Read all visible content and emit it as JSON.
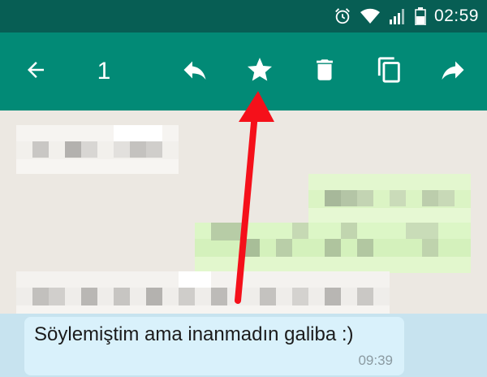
{
  "status_bar": {
    "time": "02:59",
    "icons": [
      "alarm-icon",
      "wifi-icon",
      "signal-icon",
      "battery-icon"
    ]
  },
  "action_bar": {
    "selected_count": "1",
    "actions": [
      "back-arrow-icon",
      "reply-icon",
      "star-icon",
      "delete-icon",
      "copy-icon",
      "forward-icon"
    ]
  },
  "message": {
    "text": "Söylemiştim ama inanmadın galiba :)",
    "time": "09:39"
  },
  "colors": {
    "status_bar": "#075e54",
    "action_bar": "#028a76",
    "annotation_arrow": "#f5101a"
  }
}
